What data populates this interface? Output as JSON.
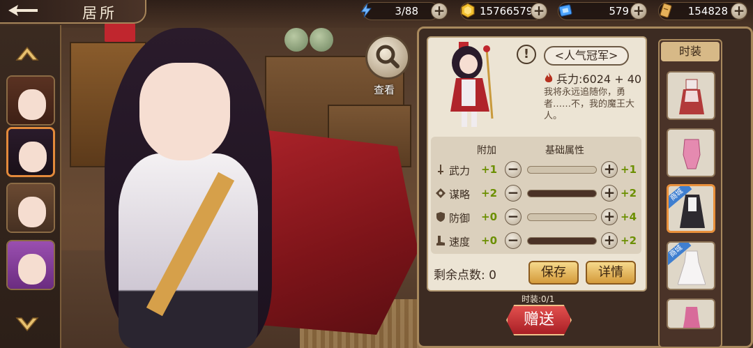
{
  "header": {
    "title": "居所"
  },
  "resources": [
    {
      "icon": "lightning-icon",
      "value": "3/88",
      "color": "#6fb6ff"
    },
    {
      "icon": "gold-coin-icon",
      "value": "15766579",
      "color": "#f2c02e"
    },
    {
      "icon": "blue-gem-icon",
      "value": "579",
      "color": "#4aa3ff"
    },
    {
      "icon": "scroll-token-icon",
      "value": "154828",
      "color": "#e6b25a"
    }
  ],
  "search": {
    "label": "查看"
  },
  "character": {
    "title": "<人气冠军>",
    "power": "兵力:6024 + 40",
    "quote": "我将永远追随你，勇者……不，我的魔王大人。"
  },
  "stats": {
    "header_bonus": "附加",
    "header_base": "基础属性",
    "rows": [
      {
        "icon": "sword-icon",
        "name": "武力",
        "bonus": "+1",
        "base": "+1",
        "fill": 0.0
      },
      {
        "icon": "strategy-icon",
        "name": "谋略",
        "bonus": "+2",
        "base": "+2",
        "fill": 1.0
      },
      {
        "icon": "shield-icon",
        "name": "防御",
        "bonus": "+0",
        "base": "+4",
        "fill": 0.0
      },
      {
        "icon": "boot-icon",
        "name": "速度",
        "bonus": "+0",
        "base": "+2",
        "fill": 1.0
      }
    ],
    "remaining_label": "剩余点数:",
    "remaining_value": "0"
  },
  "buttons": {
    "save": "保存",
    "details": "详情",
    "gift": "赠送"
  },
  "outfits": {
    "header": "时装",
    "count": "时装:0/1",
    "shop_tag": "商城",
    "items": [
      {
        "name": "red-dress-outfit",
        "shop": false,
        "selected": false
      },
      {
        "name": "pink-swimsuit-outfit",
        "shop": false,
        "selected": false
      },
      {
        "name": "black-maid-outfit",
        "shop": true,
        "selected": true
      },
      {
        "name": "white-gown-outfit",
        "shop": true,
        "selected": false
      },
      {
        "name": "pink-dress-outfit",
        "shop": false,
        "selected": false
      }
    ]
  }
}
